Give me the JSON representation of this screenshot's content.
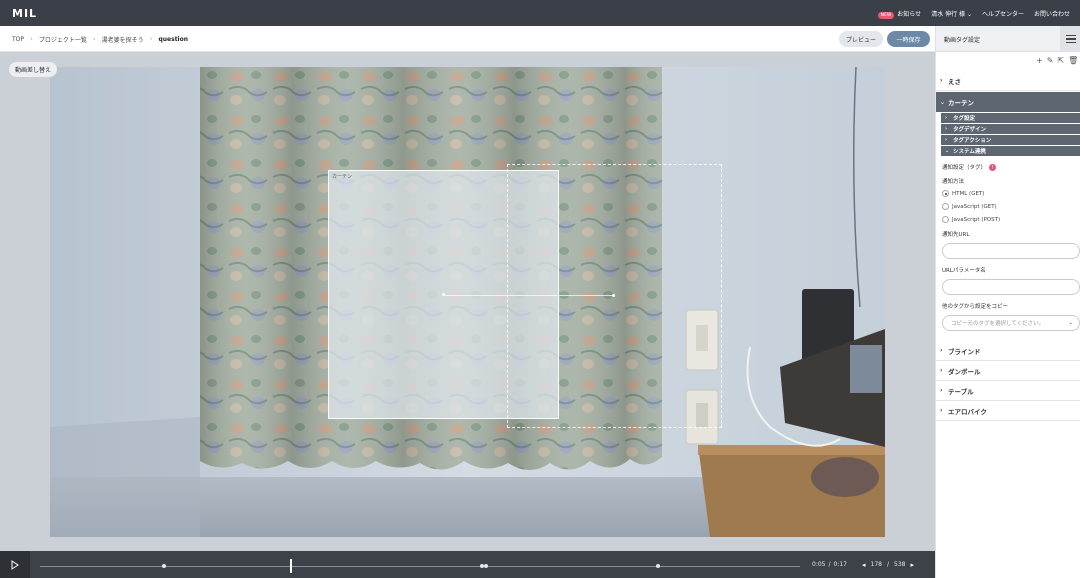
{
  "header": {
    "logo": "MIL",
    "new_badge": "NEW",
    "notice": "お知らせ",
    "user": "清水 伸行 様",
    "help": "ヘルプセンター",
    "contact": "お問い合わせ"
  },
  "breadcrumb": [
    "TOP",
    "プロジェクト一覧",
    "湯老婆を探そう",
    "question"
  ],
  "toolbar": {
    "preview_label": "プレビュー",
    "save_label": "一時保存"
  },
  "stage": {
    "replace_label": "動画差し替え",
    "tag_label": "カーテン"
  },
  "player": {
    "current_time": "0:05",
    "total_time": "0:17",
    "time_sep": "/",
    "current_frame": "178",
    "total_frames": "538",
    "frame_sep": "/",
    "progress": 0.33
  },
  "panel": {
    "title": "動画タグ設定",
    "sections": {
      "esa": "えさ",
      "curtain": "カーテン",
      "blind": "ブラインド",
      "cardboard": "ダンボール",
      "table": "テーブル",
      "aerobike": "エアロバイク"
    },
    "subs": {
      "tag_settings": "タグ設定",
      "tag_design": "タグデザイン",
      "tag_action": "タグアクション",
      "system_link": "システム連携"
    },
    "notify": {
      "heading": "通知設定（タグ）",
      "req": "!",
      "method_label": "通知方法",
      "methods": [
        "HTML (GET)",
        "JavaScript (GET)",
        "JavaScript (POST)"
      ],
      "selected": 0,
      "url_label": "通知先URL",
      "url_value": "",
      "param_label": "URLパラメータ名",
      "param_value": "",
      "copy_label": "他のタグから設定をコピー",
      "copy_placeholder": "コピー元のタグを選択してください。"
    }
  },
  "colors": {
    "topbar": "#3b4048",
    "accent": "#6c8aa8",
    "section_dark": "#5d6671",
    "badge": "#e85b6f"
  }
}
